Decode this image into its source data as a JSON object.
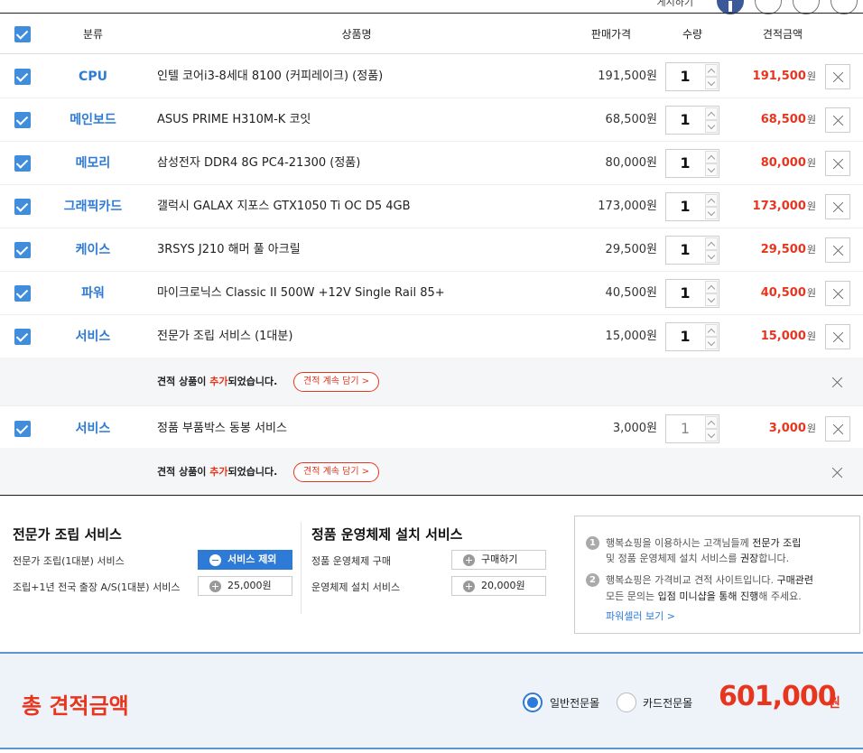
{
  "share": {
    "label": "게시하기"
  },
  "header": {
    "category": "분류",
    "product": "상품명",
    "price": "판매가격",
    "qty": "수량",
    "total": "견적금액"
  },
  "items": [
    {
      "category": "CPU",
      "name": "인텔 코어i3-8세대 8100 (커피레이크) (정품)",
      "price": "191,500원",
      "qty": "1",
      "total": "191,500",
      "won": "원"
    },
    {
      "category": "메인보드",
      "name": "ASUS PRIME H310M-K 코잇",
      "price": "68,500원",
      "qty": "1",
      "total": "68,500",
      "won": "원"
    },
    {
      "category": "메모리",
      "name": "삼성전자 DDR4 8G PC4-21300 (정품)",
      "price": "80,000원",
      "qty": "1",
      "total": "80,000",
      "won": "원"
    },
    {
      "category": "그래픽카드",
      "name": "갤럭시 GALAX 지포스 GTX1050 Ti OC D5 4GB",
      "price": "173,000원",
      "qty": "1",
      "total": "173,000",
      "won": "원"
    },
    {
      "category": "케이스",
      "name": "3RSYS J210 해머 풀 아크릴",
      "price": "29,500원",
      "qty": "1",
      "total": "29,500",
      "won": "원"
    },
    {
      "category": "파워",
      "name": "마이크로닉스 Classic II 500W +12V Single Rail 85+",
      "price": "40,500원",
      "qty": "1",
      "total": "40,500",
      "won": "원"
    },
    {
      "category": "서비스",
      "name": "전문가 조립 서비스 (1대분)",
      "price": "15,000원",
      "qty": "1",
      "total": "15,000",
      "won": "원"
    },
    {
      "category": "서비스",
      "name": "정품 부품박스 동봉 서비스",
      "price": "3,000원",
      "qty": "1",
      "total": "3,000",
      "won": "원"
    }
  ],
  "notice": {
    "prefix": "견적 상품이 ",
    "highlight": "추가",
    "suffix": "되었습니다.",
    "button": "견적 계속 담기 >"
  },
  "assembly": {
    "title": "전문가 조립 서비스",
    "row1_label": "전문가 조립(1대분) 서비스",
    "row1_button": "서비스 제외",
    "row2_label": "조립+1년 전국 출장 A/S(1대분) 서비스",
    "row2_button": "25,000원"
  },
  "os": {
    "title": "정품 운영체제 설치 서비스",
    "row1_label": "정품 운영체제 구매",
    "row1_button": "구매하기",
    "row2_label": "운영체제 설치 서비스",
    "row2_button": "20,000원"
  },
  "info": {
    "n1": "1",
    "line1a": "행복쇼핑을 이용하시는 고객님들께 ",
    "line1b": "전문가 조립",
    "line2a": "및 정품 운영체제 설치 서비스를 ",
    "line2b": "권장",
    "line2c": "합니다.",
    "n2": "2",
    "line3a": "행복쇼핑은 가격비교 견적 사이트입니다. ",
    "line3b": "구매관련",
    "line4a": "모든 문의는 ",
    "line4b": "입점 미니샵을 통해 진행",
    "line4c": "해 주세요.",
    "link": "파워셀러 보기 >"
  },
  "summary": {
    "title": "총 견적금액",
    "radio1": "일반전문몰",
    "radio2": "카드전문몰",
    "amount": "601,000",
    "won": "원"
  },
  "colors": {
    "accent": "#2d7bd6",
    "price_red": "#e8351e",
    "total_bg": "#eef3fa"
  }
}
